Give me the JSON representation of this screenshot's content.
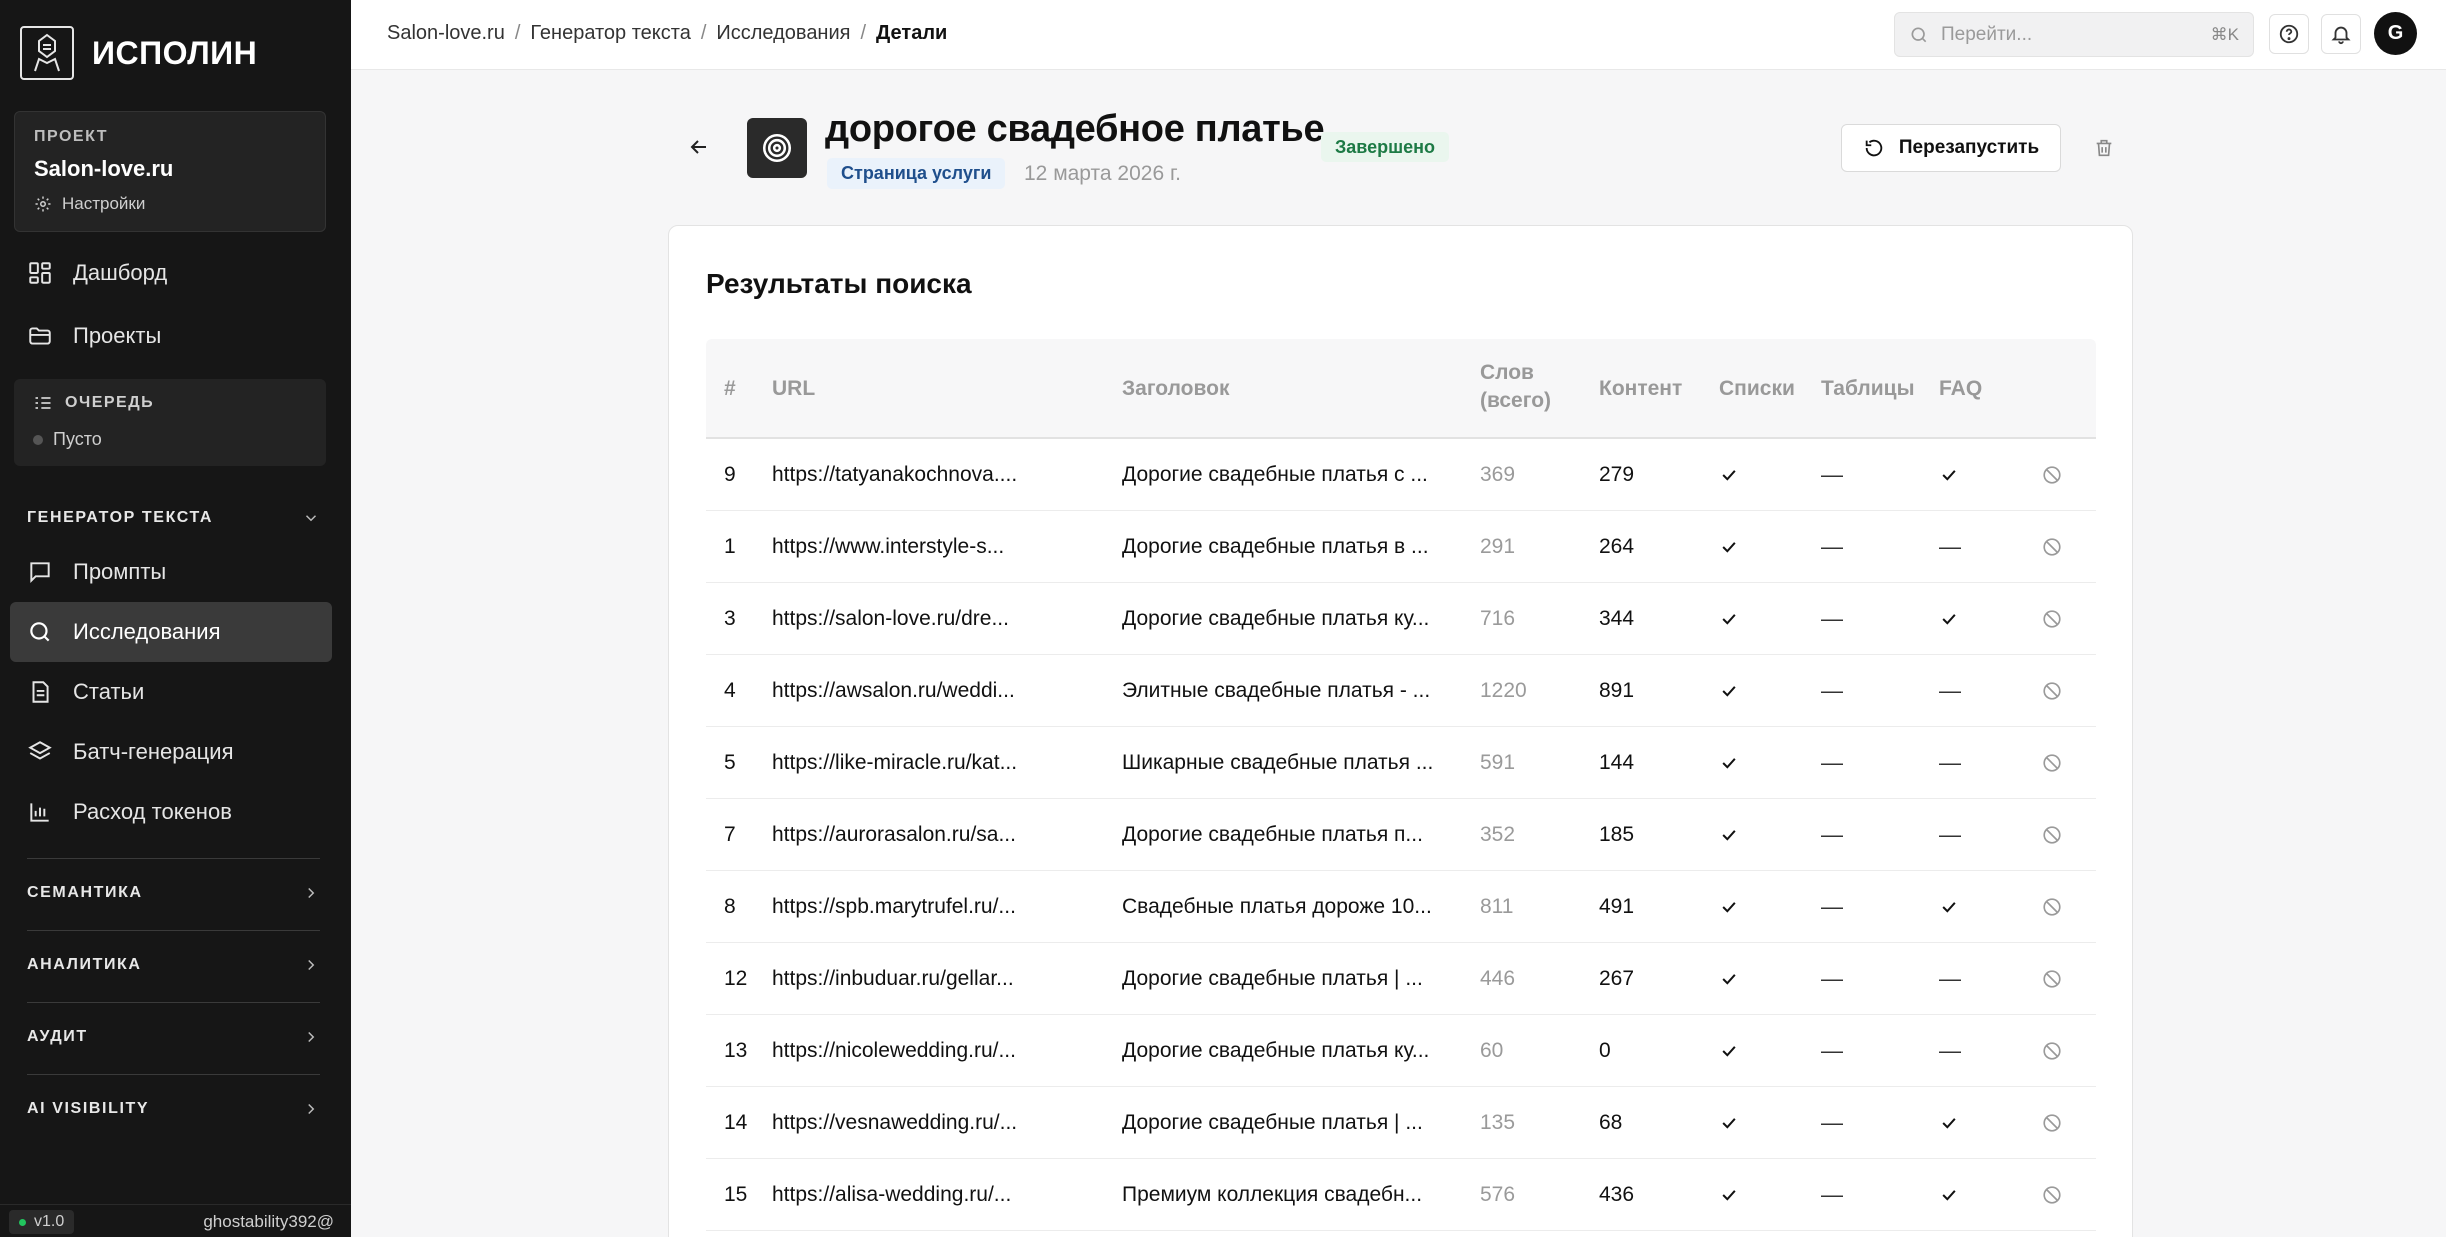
{
  "sidebar": {
    "brand": "ИСПОЛИН",
    "project": {
      "eyebrow": "ПРОЕКТ",
      "name": "Salon-love.ru",
      "settings": "Настройки"
    },
    "nav_top": [
      {
        "label": "Дашборд",
        "icon": "dashboard-icon"
      },
      {
        "label": "Проекты",
        "icon": "folder-icon"
      }
    ],
    "queue": {
      "title": "ОЧЕРЕДЬ",
      "status": "Пусто"
    },
    "text_generator": {
      "title": "ГЕНЕРАТОР ТЕКСТА",
      "items": [
        {
          "label": "Промпты",
          "icon": "message-icon"
        },
        {
          "label": "Исследования",
          "icon": "search-icon",
          "active": true
        },
        {
          "label": "Статьи",
          "icon": "document-icon"
        },
        {
          "label": "Батч-генерация",
          "icon": "layers-icon"
        },
        {
          "label": "Расход токенов",
          "icon": "bar-chart-icon"
        }
      ]
    },
    "sections": [
      "СЕМАНТИКА",
      "АНАЛИТИКА",
      "АУДИТ",
      "AI VISIBILITY"
    ],
    "version": "v1.0",
    "user": "ghostability392@"
  },
  "topbar": {
    "breadcrumb": [
      "Salon-love.ru",
      "Генератор текста",
      "Исследования",
      "Детали"
    ],
    "search_placeholder": "Перейти...",
    "search_shortcut": "⌘K",
    "avatar_initial": "G"
  },
  "header": {
    "title": "дорогое свадебное платье",
    "status": "Завершено",
    "type": "Страница услуги",
    "date": "12 марта 2026 г.",
    "restart_label": "Перезапустить"
  },
  "results": {
    "title": "Результаты поиска",
    "columns": {
      "num": "#",
      "url": "URL",
      "title": "Заголовок",
      "words_1": "Слов",
      "words_2": "(всего)",
      "content": "Контент",
      "lists": "Списки",
      "tables": "Таблицы",
      "faq": "FAQ"
    },
    "rows": [
      {
        "num": "9",
        "url": "https://tatyanakochnova....",
        "title": "Дорогие свадебные платья с ...",
        "words": "369",
        "content": "279",
        "lists": true,
        "tables": false,
        "faq": true
      },
      {
        "num": "1",
        "url": "https://www.interstyle-s...",
        "title": "Дорогие свадебные платья в ...",
        "words": "291",
        "content": "264",
        "lists": true,
        "tables": false,
        "faq": false
      },
      {
        "num": "3",
        "url": "https://salon-love.ru/dre...",
        "title": "Дорогие свадебные платья ку...",
        "words": "716",
        "content": "344",
        "lists": true,
        "tables": false,
        "faq": true
      },
      {
        "num": "4",
        "url": "https://awsalon.ru/weddi...",
        "title": "Элитные свадебные платья - ...",
        "words": "1220",
        "content": "891",
        "lists": true,
        "tables": false,
        "faq": false
      },
      {
        "num": "5",
        "url": "https://like-miracle.ru/kat...",
        "title": "Шикарные свадебные платья ...",
        "words": "591",
        "content": "144",
        "lists": true,
        "tables": false,
        "faq": false
      },
      {
        "num": "7",
        "url": "https://aurorasalon.ru/sa...",
        "title": "Дорогие свадебные платья п...",
        "words": "352",
        "content": "185",
        "lists": true,
        "tables": false,
        "faq": false
      },
      {
        "num": "8",
        "url": "https://spb.marytrufel.ru/...",
        "title": "Свадебные платья дороже 10...",
        "words": "811",
        "content": "491",
        "lists": true,
        "tables": false,
        "faq": true
      },
      {
        "num": "12",
        "url": "https://inbuduar.ru/gellar...",
        "title": "Дорогие свадебные платья | ...",
        "words": "446",
        "content": "267",
        "lists": true,
        "tables": false,
        "faq": false
      },
      {
        "num": "13",
        "url": "https://nicolewedding.ru/...",
        "title": "Дорогие свадебные платья ку...",
        "words": "60",
        "content": "0",
        "lists": true,
        "tables": false,
        "faq": false
      },
      {
        "num": "14",
        "url": "https://vesnawedding.ru/...",
        "title": "Дорогие свадебные платья | ...",
        "words": "135",
        "content": "68",
        "lists": true,
        "tables": false,
        "faq": true
      },
      {
        "num": "15",
        "url": "https://alisa-wedding.ru/...",
        "title": "Премиум коллекция свадебн...",
        "words": "576",
        "content": "436",
        "lists": true,
        "tables": false,
        "faq": true
      }
    ]
  }
}
